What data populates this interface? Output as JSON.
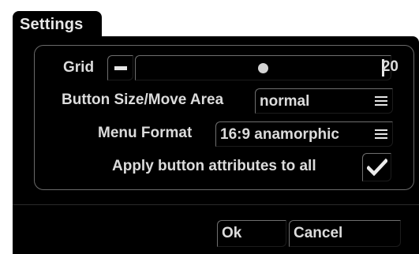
{
  "dialog": {
    "tab_title": "Settings"
  },
  "grid": {
    "label": "Grid",
    "value": "20",
    "slider_fraction": 0.55
  },
  "button_size": {
    "label": "Button Size/Move Area",
    "value": "normal",
    "icon": "menu-icon"
  },
  "menu_format": {
    "label": "Menu Format",
    "value": "16:9 anamorphic",
    "icon": "menu-icon"
  },
  "apply_attributes": {
    "label": "Apply button attributes to all",
    "checked": true,
    "icon": "checkmark-icon"
  },
  "actions": {
    "ok_label": "Ok",
    "cancel_label": "Cancel"
  },
  "colors": {
    "background": "#000000",
    "text": "#dcdcdc",
    "border_light": "#6f6f6f"
  }
}
